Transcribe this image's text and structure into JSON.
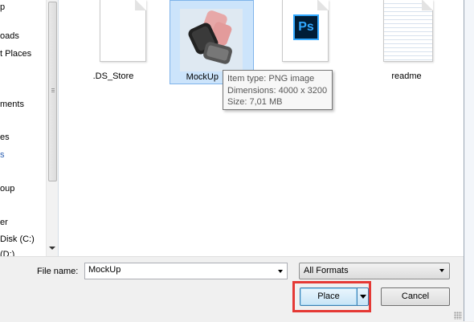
{
  "sidebar": {
    "items": [
      {
        "label": "p",
        "color": "#000000"
      },
      {
        "label": "oads",
        "color": "#000000"
      },
      {
        "label": "t Places",
        "color": "#000000"
      },
      {
        "label": "ments",
        "color": "#000000"
      },
      {
        "label": "es",
        "color": "#000000"
      },
      {
        "label": "s",
        "color": "#2a5db0"
      },
      {
        "label": "oup",
        "color": "#000000"
      },
      {
        "label": "er",
        "color": "#000000"
      },
      {
        "label": "Disk (C:)",
        "color": "#000000"
      },
      {
        "label": "(D:)",
        "color": "#000000"
      }
    ]
  },
  "files": [
    {
      "name": ".DS_Store",
      "icon": "blank-document-icon"
    },
    {
      "name": "MockUp",
      "icon": "watch-image-thumbnail",
      "selected": true
    },
    {
      "name": "",
      "icon": "photoshop-document-icon",
      "badge": "Ps"
    },
    {
      "name": "readme",
      "icon": "text-document-icon"
    }
  ],
  "tooltip": {
    "line1": "Item type: PNG image",
    "line2": "Dimensions: 4000 x 3200",
    "line3": "Size: 7,01 MB"
  },
  "footer": {
    "file_name_label": "File name:",
    "file_name_value": "MockUp",
    "format_value": "All Formats",
    "place_label": "Place",
    "cancel_label": "Cancel"
  },
  "colors": {
    "selection": "#cce4fb",
    "highlight": "#e53935",
    "ps_accent": "#31a8ff"
  }
}
